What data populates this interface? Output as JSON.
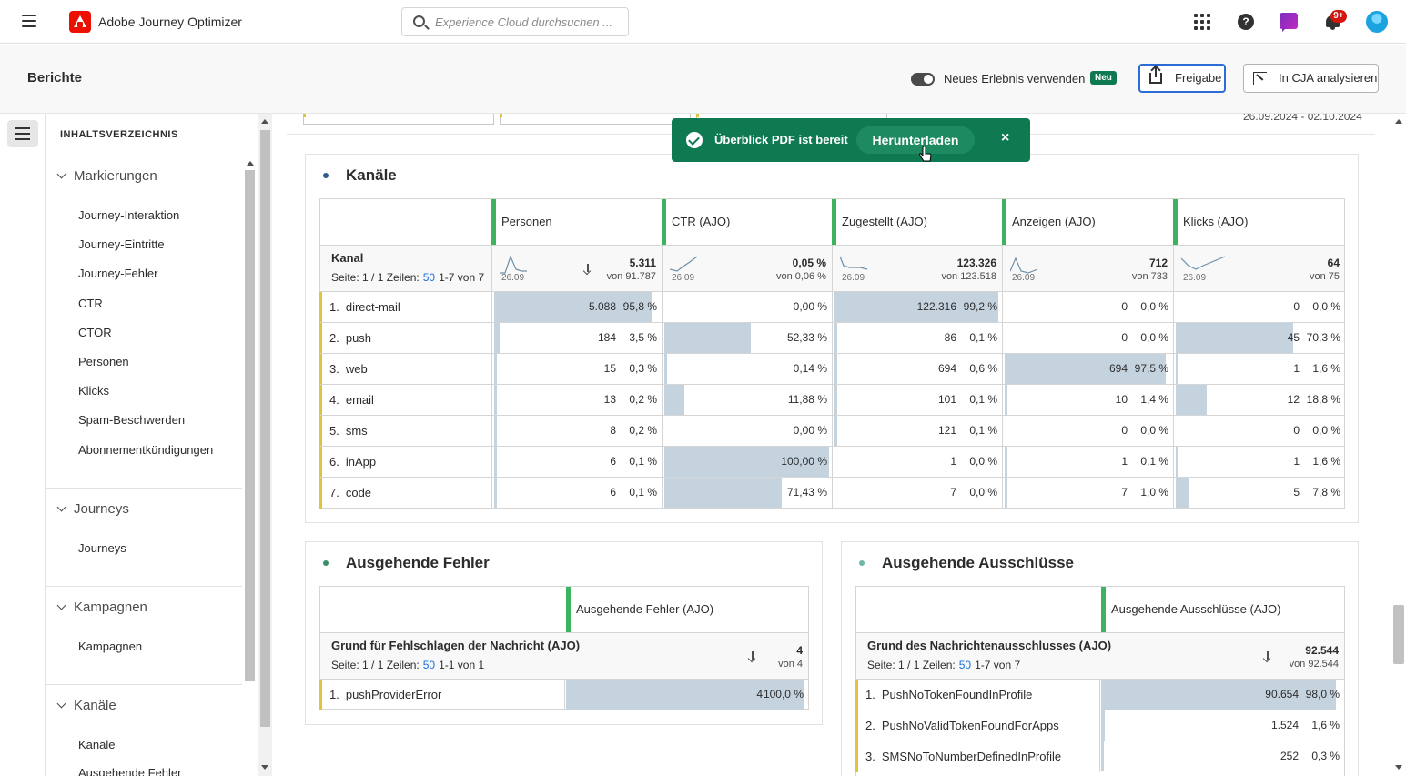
{
  "shell": {
    "app_title": "Adobe Journey Optimizer",
    "search_placeholder": "Experience Cloud durchsuchen ...",
    "notification_badge": "9+"
  },
  "header": {
    "title": "Berichte",
    "toggle_label": "Neues Erlebnis verwenden",
    "new_badge": "Neu",
    "share_label": "Freigabe",
    "cja_label": "In CJA analysieren"
  },
  "toast": {
    "message": "Überblick PDF ist bereit",
    "action": "Herunterladen",
    "close": "×"
  },
  "toc": {
    "heading": "INHALTSVERZEICHNIS",
    "sections": [
      {
        "title": "Markierungen",
        "items": [
          "Journey-Interaktion",
          "Journey-Eintritte",
          "Journey-Fehler",
          "CTR",
          "CTOR",
          "Personen",
          "Klicks",
          "Spam-Beschwerden",
          "Abonnementkündigungen"
        ]
      },
      {
        "title": "Journeys",
        "items": [
          "Journeys"
        ]
      },
      {
        "title": "Kampagnen",
        "items": [
          "Kampagnen"
        ]
      },
      {
        "title": "Kanäle",
        "items": [
          "Kanäle",
          "Ausgehende Fehler"
        ]
      }
    ]
  },
  "fragment": {
    "date_range": "26.09.2024 - 02.10.2024"
  },
  "channels": {
    "title": "Kanäle",
    "dimension": "Kanal",
    "page_prefix": "Seite: 1 / 1 Zeilen:",
    "page_size": "50",
    "page_range": "1-7 von 7",
    "columns": [
      {
        "name": "Personen",
        "total": "5.311",
        "of": "von 91.787",
        "spark_date": "26.09"
      },
      {
        "name": "CTR (AJO)",
        "total": "0,05 %",
        "of": "von 0,06 %",
        "spark_date": "26.09"
      },
      {
        "name": "Zugestellt (AJO)",
        "total": "123.326",
        "of": "von 123.518",
        "spark_date": "26.09"
      },
      {
        "name": "Anzeigen (AJO)",
        "total": "712",
        "of": "von 733",
        "spark_date": "26.09"
      },
      {
        "name": "Klicks (AJO)",
        "total": "64",
        "of": "von 75",
        "spark_date": "26.09"
      }
    ],
    "rows": [
      {
        "num": "1.",
        "label": "direct-mail",
        "cells": [
          [
            "5.088",
            "95,8 %"
          ],
          [
            "0,00 %"
          ],
          [
            "122.316",
            "99,2 %"
          ],
          [
            "0",
            "0,0 %"
          ],
          [
            "0",
            "0,0 %"
          ]
        ],
        "fills": [
          0.958,
          0.0,
          0.992,
          0.0,
          0.0
        ]
      },
      {
        "num": "2.",
        "label": "push",
        "cells": [
          [
            "184",
            "3,5 %"
          ],
          [
            "52,33 %"
          ],
          [
            "86",
            "0,1 %"
          ],
          [
            "0",
            "0,0 %"
          ],
          [
            "45",
            "70,3 %"
          ]
        ],
        "fills": [
          0.035,
          0.5233,
          0.001,
          0.0,
          0.703
        ]
      },
      {
        "num": "3.",
        "label": "web",
        "cells": [
          [
            "15",
            "0,3 %"
          ],
          [
            "0,14 %"
          ],
          [
            "694",
            "0,6 %"
          ],
          [
            "694",
            "97,5 %"
          ],
          [
            "1",
            "1,6 %"
          ]
        ],
        "fills": [
          0.003,
          0.0014,
          0.006,
          0.975,
          0.016
        ]
      },
      {
        "num": "4.",
        "label": "email",
        "cells": [
          [
            "13",
            "0,2 %"
          ],
          [
            "11,88 %"
          ],
          [
            "101",
            "0,1 %"
          ],
          [
            "10",
            "1,4 %"
          ],
          [
            "12",
            "18,8 %"
          ]
        ],
        "fills": [
          0.002,
          0.1188,
          0.001,
          0.014,
          0.188
        ]
      },
      {
        "num": "5.",
        "label": "sms",
        "cells": [
          [
            "8",
            "0,2 %"
          ],
          [
            "0,00 %"
          ],
          [
            "121",
            "0,1 %"
          ],
          [
            "0",
            "0,0 %"
          ],
          [
            "0",
            "0,0 %"
          ]
        ],
        "fills": [
          0.002,
          0.0,
          0.001,
          0.0,
          0.0
        ]
      },
      {
        "num": "6.",
        "label": "inApp",
        "cells": [
          [
            "6",
            "0,1 %"
          ],
          [
            "100,00 %"
          ],
          [
            "1",
            "0,0 %"
          ],
          [
            "1",
            "0,1 %"
          ],
          [
            "1",
            "1,6 %"
          ]
        ],
        "fills": [
          0.001,
          1.0,
          0.0,
          0.001,
          0.016
        ]
      },
      {
        "num": "7.",
        "label": "code",
        "cells": [
          [
            "6",
            "0,1 %"
          ],
          [
            "71,43 %"
          ],
          [
            "7",
            "0,0 %"
          ],
          [
            "7",
            "1,0 %"
          ],
          [
            "5",
            "7,8 %"
          ]
        ],
        "fills": [
          0.001,
          0.7143,
          0.0,
          0.01,
          0.078
        ]
      }
    ]
  },
  "errors": {
    "title": "Ausgehende Fehler",
    "column": "Ausgehende Fehler (AJO)",
    "dimension": "Grund für Fehlschlagen der Nachricht (AJO)",
    "page_prefix": "Seite: 1 / 1 Zeilen:",
    "page_size": "50",
    "page_range": "1-1 von 1",
    "total": "4",
    "of": "von 4",
    "rows": [
      {
        "num": "1.",
        "label": "pushProviderError",
        "value": "4",
        "pct": "100,0 %",
        "fill": 1.0
      }
    ]
  },
  "exclusions": {
    "title": "Ausgehende Ausschlüsse",
    "column": "Ausgehende Ausschlüsse (AJO)",
    "dimension": "Grund des Nachrichtenausschlusses (AJO)",
    "page_prefix": "Seite: 1 / 1 Zeilen:",
    "page_size": "50",
    "page_range": "1-7 von 7",
    "total": "92.544",
    "of": "von 92.544",
    "rows": [
      {
        "num": "1.",
        "label": "PushNoTokenFoundInProfile",
        "value": "90.654",
        "pct": "98,0 %",
        "fill": 0.98
      },
      {
        "num": "2.",
        "label": "PushNoValidTokenFoundForApps",
        "value": "1.524",
        "pct": "1,6 %",
        "fill": 0.016
      },
      {
        "num": "3.",
        "label": "SMSNoToNumberDefinedInProfile",
        "value": "252",
        "pct": "0,3 %",
        "fill": 0.003
      }
    ]
  },
  "colors": {
    "toast_bg": "#0f7a52",
    "metric_bar": "#3db35f",
    "row_marker": "#e0c43b",
    "cell_fill": "#c5d3df",
    "link": "#1a6fdc",
    "dot_blue": "#2d5b8a",
    "dot_green": "#3a8f6b",
    "dot_teal": "#6fb7a6"
  }
}
